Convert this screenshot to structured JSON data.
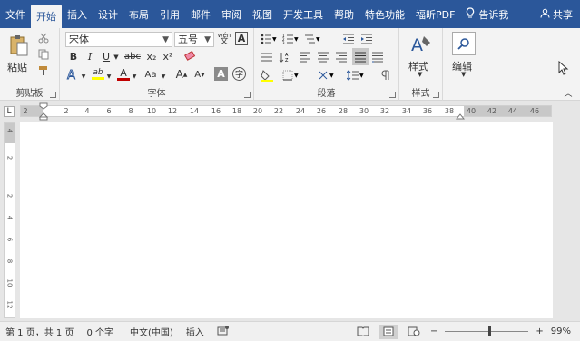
{
  "menu": {
    "tabs": [
      {
        "label": "文件"
      },
      {
        "label": "开始"
      },
      {
        "label": "插入"
      },
      {
        "label": "设计"
      },
      {
        "label": "布局"
      },
      {
        "label": "引用"
      },
      {
        "label": "邮件"
      },
      {
        "label": "审阅"
      },
      {
        "label": "视图"
      },
      {
        "label": "开发工具"
      },
      {
        "label": "帮助"
      },
      {
        "label": "特色功能"
      },
      {
        "label": "福昕PDF"
      }
    ],
    "tell_me": "告诉我",
    "share": "共享"
  },
  "ribbon": {
    "clipboard": {
      "label": "剪贴板",
      "paste": "粘贴"
    },
    "font": {
      "label": "字体",
      "font_name": "宋体",
      "font_size": "五号",
      "wen": "wén",
      "bold": "B",
      "italic": "I",
      "underline": "U",
      "strike": "abc",
      "sub": "x₂",
      "sup": "x²",
      "grow": "A",
      "shrink": "A",
      "case": "Aa",
      "clear": "A",
      "color_a": "A",
      "char_border": "A",
      "enclose": "字"
    },
    "paragraph": {
      "label": "段落"
    },
    "styles": {
      "label": "样式",
      "button": "样式"
    },
    "editing": {
      "button": "编辑"
    }
  },
  "ruler": {
    "corner": "L",
    "ticks": [
      "2",
      "2",
      "4",
      "6",
      "8",
      "10",
      "12",
      "14",
      "16",
      "18",
      "20",
      "22",
      "24",
      "26",
      "28",
      "30",
      "32",
      "34",
      "36",
      "38",
      "40",
      "42",
      "44",
      "46"
    ],
    "vticks": [
      "4",
      "2",
      "2",
      "4",
      "6",
      "8",
      "10",
      "12"
    ]
  },
  "status": {
    "page": "第 1 页，共 1 页",
    "words": "0 个字",
    "lang": "中文(中国)",
    "mode": "插入",
    "zoom_minus": "−",
    "zoom_plus": "+",
    "zoom": "99%"
  },
  "colors": {
    "brand": "#2b579a",
    "font_color": "#c00000",
    "highlight": "#ffff00"
  }
}
